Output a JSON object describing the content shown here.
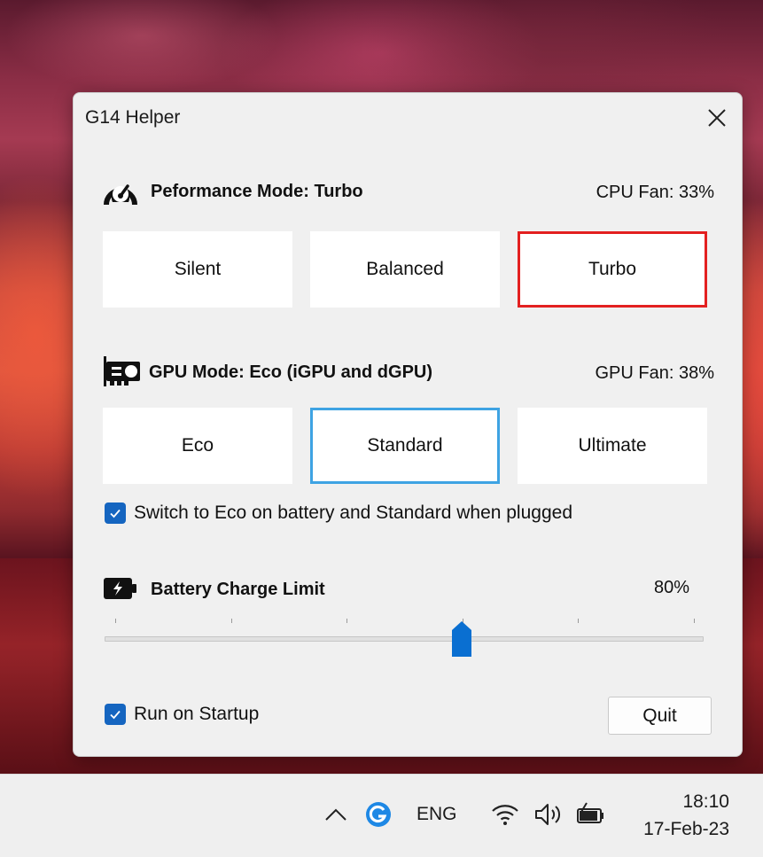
{
  "window": {
    "title": "G14 Helper",
    "close_icon": "close-icon"
  },
  "performance": {
    "icon": "speedometer-icon",
    "title": "Peformance Mode: Turbo",
    "fan_label": "CPU Fan: 33%",
    "buttons": [
      "Silent",
      "Balanced",
      "Turbo"
    ],
    "selected": "Turbo",
    "selected_color": "#e32020"
  },
  "gpu": {
    "icon": "graphics-card-icon",
    "title": "GPU Mode: Eco (iGPU and dGPU)",
    "fan_label": "GPU Fan: 38%",
    "buttons": [
      "Eco",
      "Standard",
      "Ultimate"
    ],
    "selected": "Standard",
    "selected_color": "#3ea3e3",
    "auto_switch": {
      "label": "Switch to Eco on battery and Standard when plugged",
      "checked": true
    }
  },
  "battery": {
    "icon": "battery-charging-icon",
    "title": "Battery Charge Limit",
    "value_label": "80%",
    "slider_value": 80,
    "slider_min": 50,
    "slider_max": 100
  },
  "startup": {
    "label": "Run on Startup",
    "checked": true
  },
  "quit_label": "Quit",
  "accent_color": "#1565c0",
  "taskbar": {
    "tray_chevron_icon": "chevron-up-icon",
    "app_icon": "g-helper-icon",
    "language": "ENG",
    "wifi_icon": "wifi-icon",
    "volume_icon": "speaker-icon",
    "battery_icon": "battery-charging-icon",
    "time": "18:10",
    "date": "17-Feb-23"
  }
}
